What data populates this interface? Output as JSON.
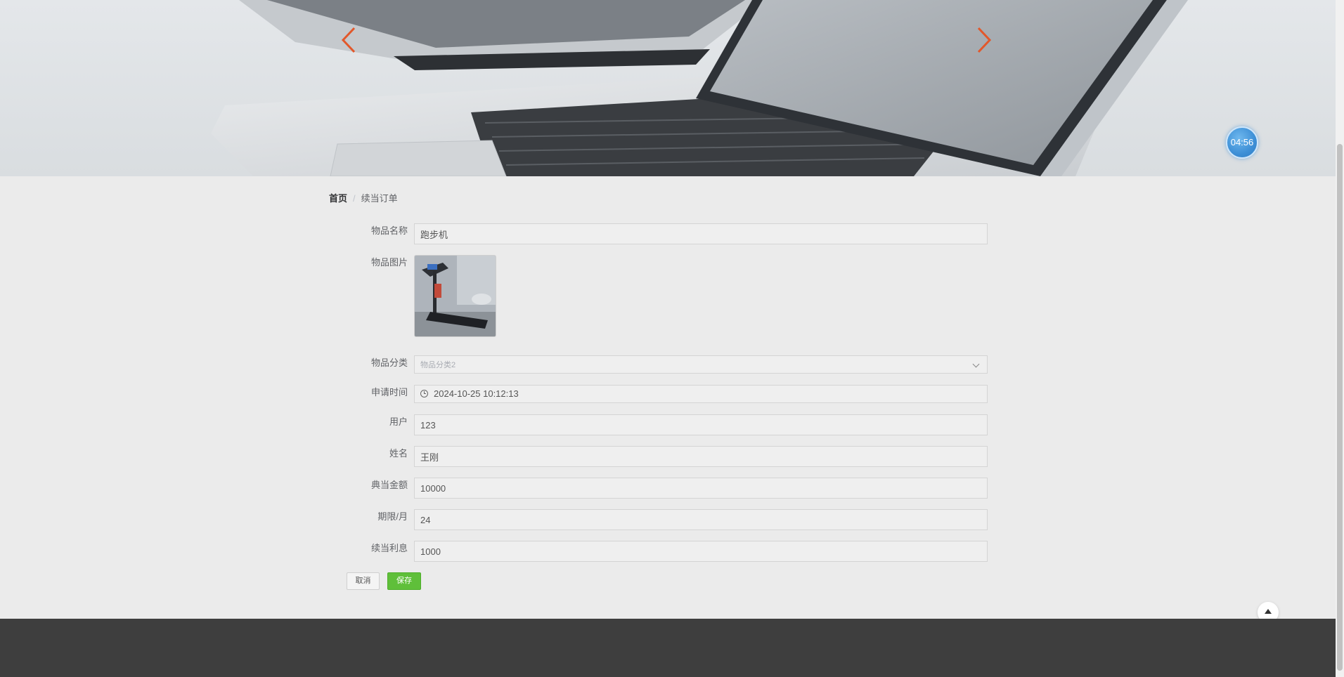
{
  "banner": {
    "timer": "04:56",
    "arrow_color": "#e2582b",
    "prev_icon": "chevron-left-icon",
    "next_icon": "chevron-right-icon"
  },
  "breadcrumb": {
    "home": "首页",
    "separator": "/",
    "current": "续当订单"
  },
  "form": {
    "item_name": {
      "label": "物品名称",
      "value": "跑步机"
    },
    "item_image": {
      "label": "物品图片"
    },
    "item_category": {
      "label": "物品分类",
      "value": "物品分类2"
    },
    "apply_time": {
      "label": "申请时间",
      "value": "2024-10-25 10:12:13"
    },
    "user": {
      "label": "用户",
      "value": "123"
    },
    "name": {
      "label": "姓名",
      "value": "王刚"
    },
    "pawn_amount": {
      "label": "典当金额",
      "value": "10000"
    },
    "term_months": {
      "label": "期限/月",
      "value": "24"
    },
    "renewal_interest": {
      "label": "续当利息",
      "value": "1000"
    }
  },
  "buttons": {
    "cancel": "取消",
    "save": "保存",
    "save_color": "#5fbf3a"
  },
  "back_to_top_icon": "caret-up-icon"
}
